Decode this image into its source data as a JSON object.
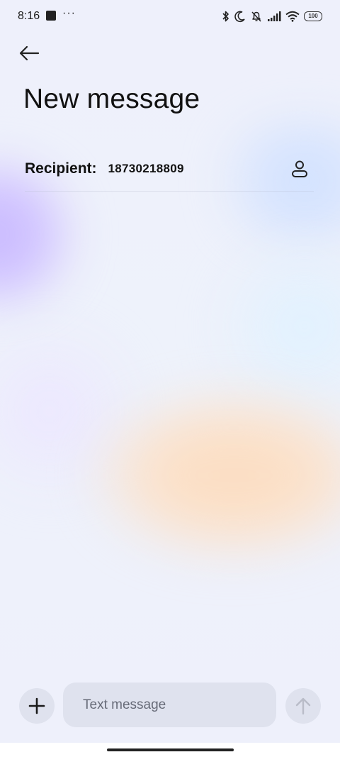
{
  "status_bar": {
    "time": "8:16",
    "more_indicator": "···",
    "battery": "100",
    "icons": [
      "app-notification-icon",
      "bluetooth-icon",
      "moon-icon",
      "bell-off-icon",
      "signal-icon",
      "wifi-icon",
      "battery-icon"
    ]
  },
  "header": {
    "back_icon": "arrow-left-icon",
    "title": "New message"
  },
  "recipient": {
    "label": "Recipient:",
    "value": "18730218809",
    "contact_icon": "person-icon"
  },
  "composer": {
    "add_icon": "plus-icon",
    "placeholder": "Text message",
    "value": "",
    "send_icon": "arrow-up-icon"
  },
  "colors": {
    "accent_text": "#111111",
    "input_bg": "#dfe2ee",
    "placeholder": "#676b78",
    "send_disabled": "#b9bcc8"
  }
}
